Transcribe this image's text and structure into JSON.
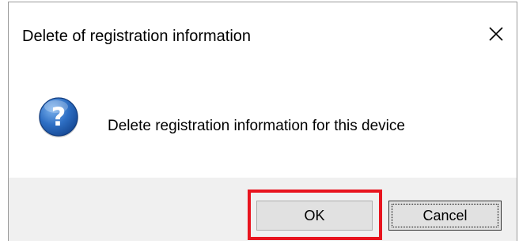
{
  "dialog": {
    "title": "Delete of registration information",
    "message": "Delete registration information for this device"
  },
  "buttons": {
    "ok_label": "OK",
    "cancel_label": "Cancel"
  },
  "icons": {
    "close": "close-icon",
    "message": "question-icon"
  },
  "colors": {
    "highlight": "#e8141e",
    "footer_bg": "#f0f0f0",
    "button_bg": "#e1e1e1",
    "icon_blue": "#1f5fb5"
  }
}
